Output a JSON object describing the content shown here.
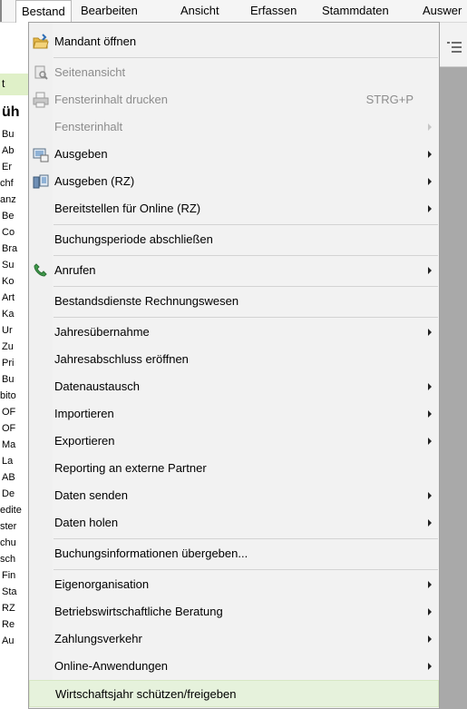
{
  "menubar": {
    "items": [
      "Bestand",
      "Bearbeiten",
      "Ansicht",
      "Erfassen",
      "Stammdaten",
      "Auswer"
    ]
  },
  "background": {
    "left_rows": [
      "t",
      "üh",
      "Bu",
      "Ab",
      "Er",
      "chf",
      "anz",
      "Be",
      "Co",
      "Bra",
      "Su",
      "Ko",
      "Art",
      "Ka",
      "Ur",
      "Zu",
      "Pri",
      "Bu",
      "bito",
      "OF",
      "OF",
      "Ma",
      "La",
      "AB",
      "De",
      "edite",
      "ster",
      "chu",
      "sch",
      "Fin",
      "Sta",
      "RZ",
      "Re",
      "Au"
    ]
  },
  "menu": {
    "items": [
      {
        "label": "Mandant öffnen",
        "icon": "folder-open-icon"
      },
      {
        "label": "Seitenansicht",
        "icon": "print-preview-icon",
        "disabled": true
      },
      {
        "label": "Fensterinhalt drucken",
        "icon": "printer-icon",
        "disabled": true,
        "shortcut": "STRG+P"
      },
      {
        "label": "Fensterinhalt",
        "disabled": true,
        "submenu": true
      },
      {
        "label": "Ausgeben",
        "icon": "output-icon",
        "submenu": true
      },
      {
        "label": "Ausgeben (RZ)",
        "icon": "output-rz-icon",
        "submenu": true
      },
      {
        "label": "Bereitstellen für Online (RZ)",
        "submenu": true
      },
      {
        "label": "Buchungsperiode abschließen"
      },
      {
        "label": "Anrufen",
        "icon": "phone-icon",
        "submenu": true
      },
      {
        "label": "Bestandsdienste Rechnungswesen"
      },
      {
        "label": "Jahresübernahme",
        "submenu": true
      },
      {
        "label": "Jahresabschluss eröffnen"
      },
      {
        "label": "Datenaustausch",
        "submenu": true
      },
      {
        "label": "Importieren",
        "submenu": true
      },
      {
        "label": "Exportieren",
        "submenu": true
      },
      {
        "label": "Reporting an externe Partner"
      },
      {
        "label": "Daten senden",
        "submenu": true
      },
      {
        "label": "Daten holen",
        "submenu": true
      },
      {
        "label": "Buchungsinformationen übergeben..."
      },
      {
        "label": "Eigenorganisation",
        "submenu": true
      },
      {
        "label": "Betriebswirtschaftliche Beratung",
        "submenu": true
      },
      {
        "label": "Zahlungsverkehr",
        "submenu": true
      },
      {
        "label": "Online-Anwendungen",
        "submenu": true
      },
      {
        "label": "Wirtschaftsjahr schützen/freigeben",
        "highlighted": true
      }
    ]
  }
}
